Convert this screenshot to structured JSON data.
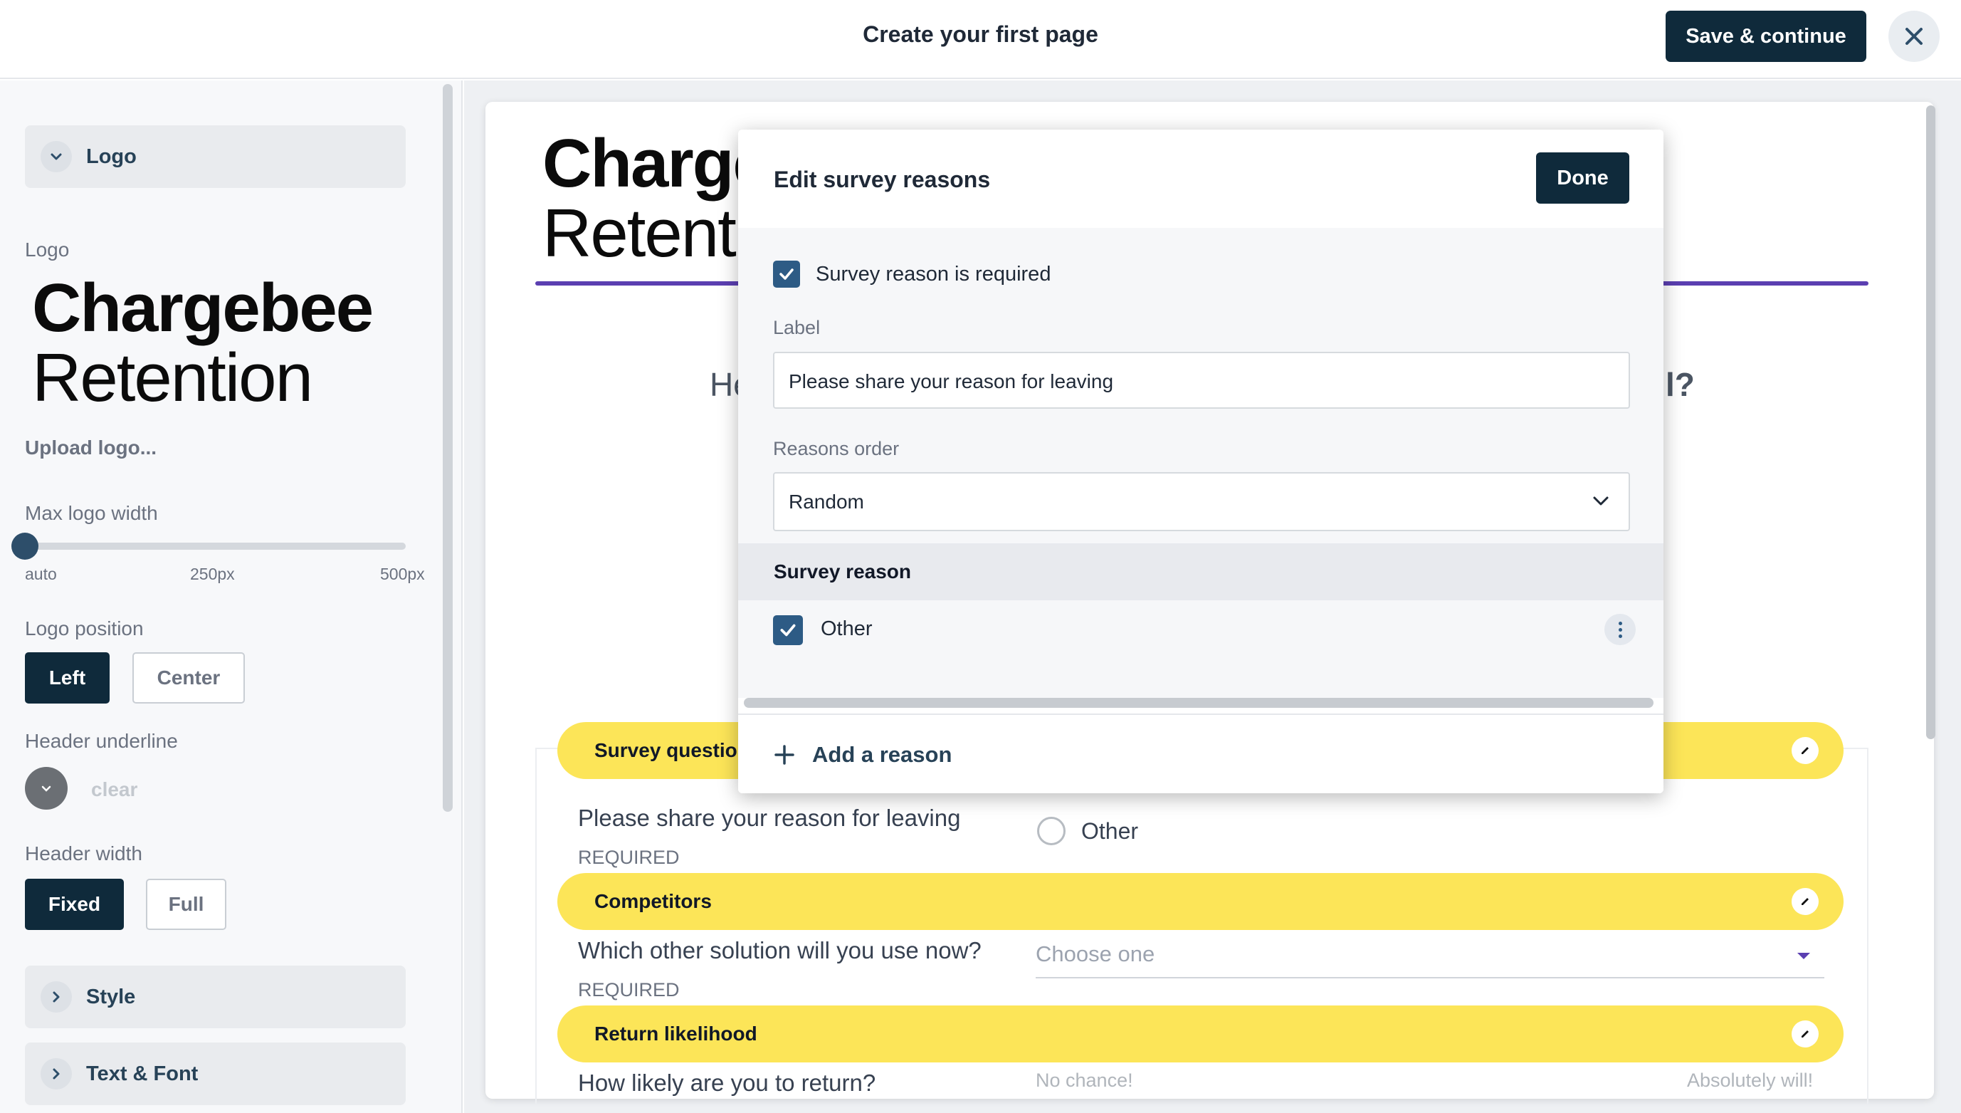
{
  "topbar": {
    "title": "Create your first page",
    "save_label": "Save & continue"
  },
  "sidebar": {
    "logo_section": "Logo",
    "logo_label": "Logo",
    "logo_line1": "Chargebee",
    "logo_line2": "Retention",
    "upload_link": "Upload logo...",
    "max_width_label": "Max logo width",
    "max_width_ticks": [
      "auto",
      "250px",
      "500px"
    ],
    "max_width_value": "auto",
    "position_label": "Logo position",
    "position_options": [
      "Left",
      "Center"
    ],
    "position_selected": "Left",
    "underline_label": "Header underline",
    "underline_clear": "clear",
    "header_width_label": "Header width",
    "header_width_options": [
      "Fixed",
      "Full"
    ],
    "header_width_selected": "Fixed",
    "style_section": "Style",
    "text_font_section": "Text & Font"
  },
  "preview": {
    "logo_line1": "Charge",
    "logo_line2": "Retenti",
    "heading_left": "He",
    "heading_right": "l?",
    "underline_color": "#5b3fb1",
    "sections": [
      {
        "title": "Survey questio",
        "question": "Please share your reason for leaving",
        "required": "REQUIRED"
      },
      {
        "title": "Competitors",
        "question": "Which other solution will you use now?",
        "required": "REQUIRED"
      },
      {
        "title": "Return likelihood",
        "question": "How likely are you to return?"
      }
    ],
    "radio_option": "Other",
    "select_placeholder": "Choose one",
    "scale_left": "No chance!",
    "scale_right": "Absolutely will!"
  },
  "modal": {
    "title": "Edit survey reasons",
    "done_label": "Done",
    "required_checkbox_label": "Survey reason is required",
    "required_checked": true,
    "label_field_label": "Label",
    "label_field_value": "Please share your reason for leaving",
    "order_label": "Reasons order",
    "order_value": "Random",
    "reasons_header": "Survey reason",
    "reasons": [
      {
        "label": "Other",
        "checked": true
      }
    ],
    "add_reason_label": "Add a reason"
  },
  "colors": {
    "primary_dark": "#0f2a3b",
    "highlight_yellow": "#fce558",
    "accent_purple": "#5b3fb1",
    "checkbox_blue": "#2d5b85"
  }
}
